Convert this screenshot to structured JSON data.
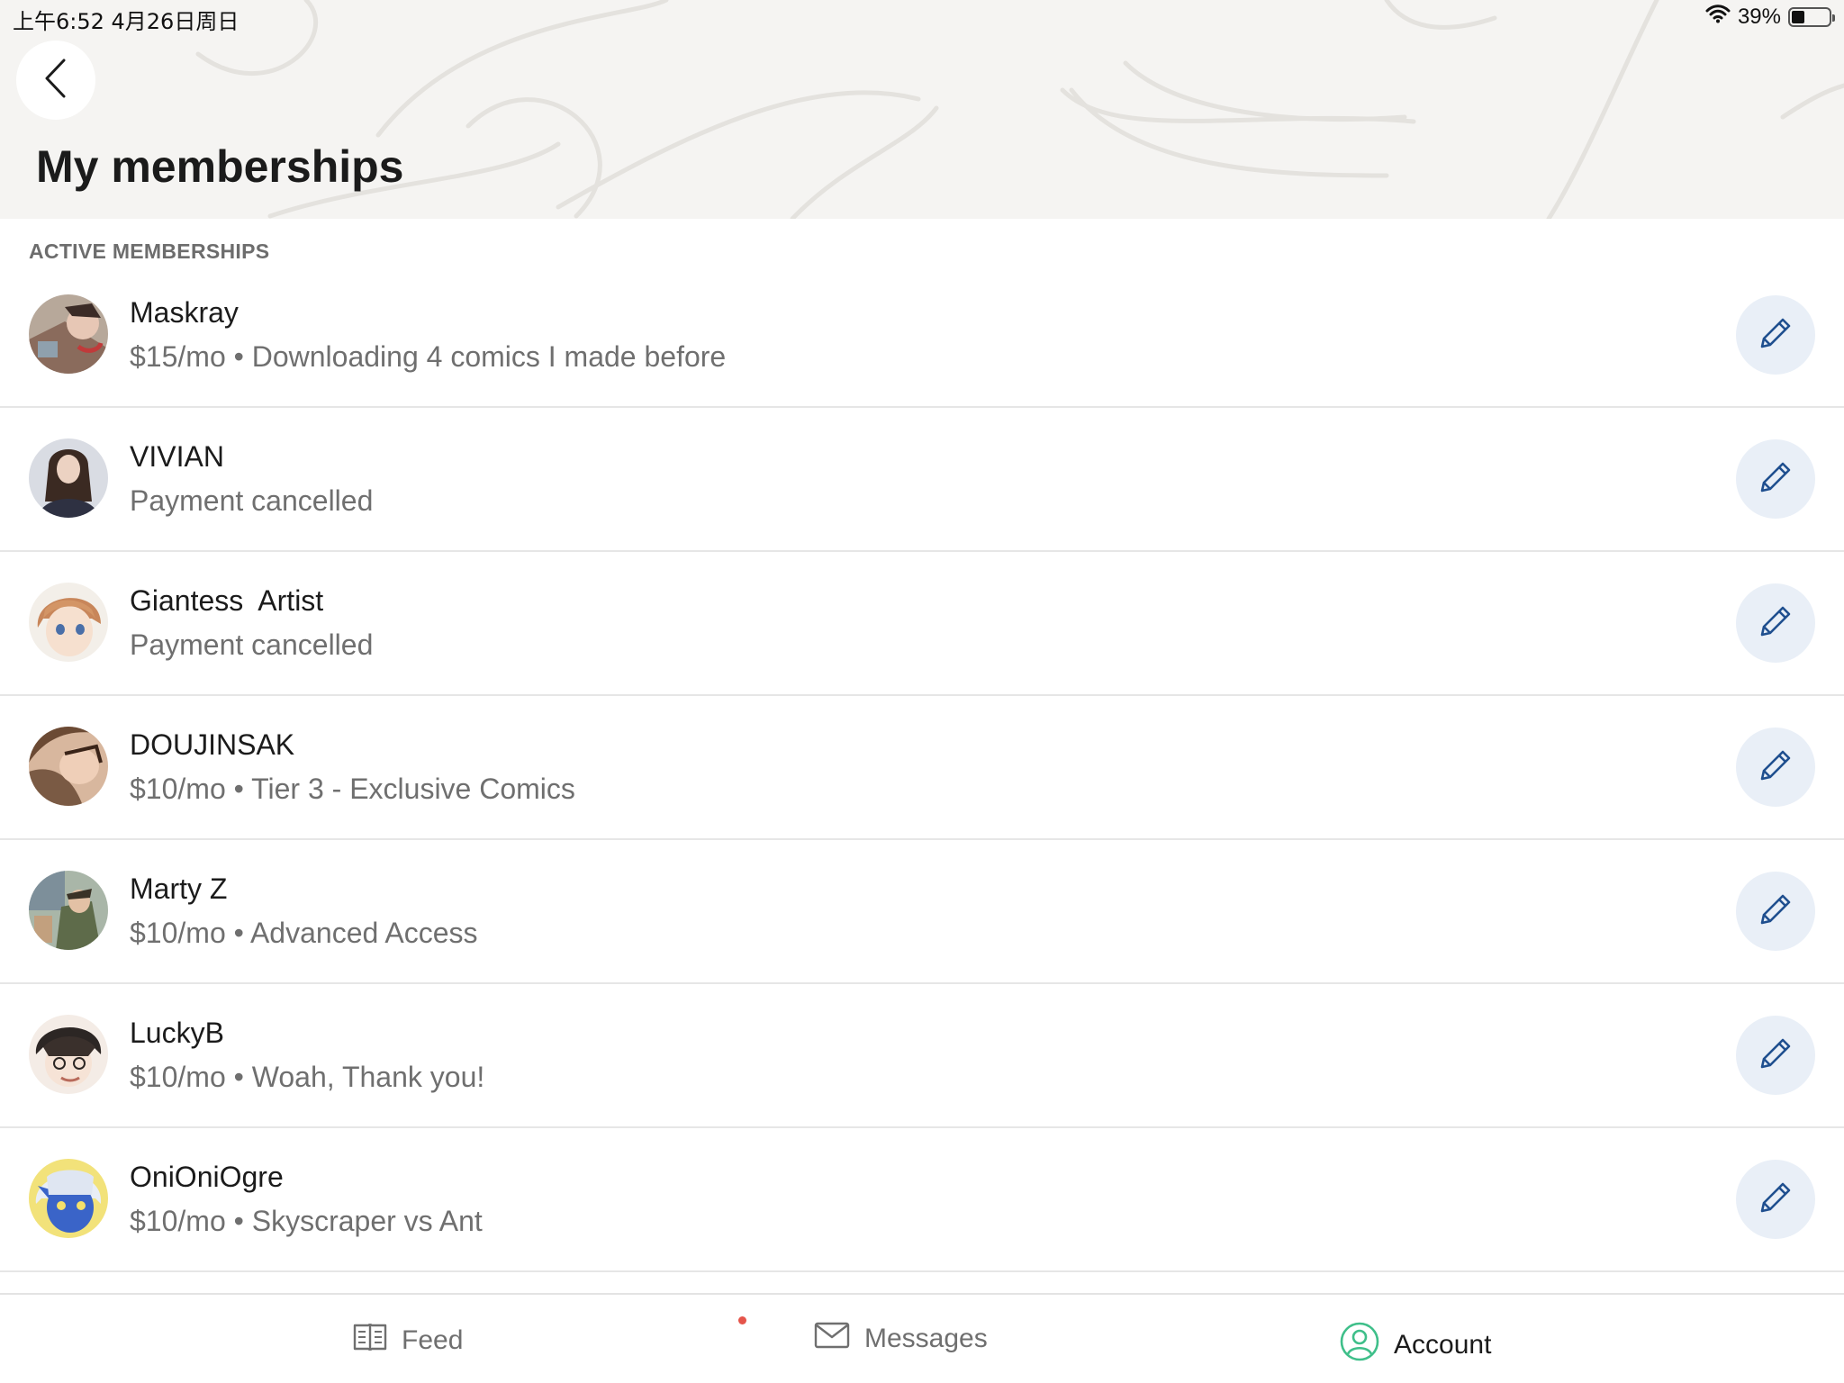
{
  "status_bar": {
    "time": "上午6:52   4月26日周日",
    "battery": "39%"
  },
  "header": {
    "title": "My memberships"
  },
  "section": {
    "label": "ACTIVE MEMBERSHIPS"
  },
  "memberships": [
    {
      "name": "Maskray",
      "detail": "$15/mo • Downloading 4 comics I made before",
      "avatar_color": "#8a6b5c"
    },
    {
      "name": "VIVIAN",
      "detail": "Payment cancelled",
      "avatar_color": "#2e3142"
    },
    {
      "name": "Giantess  Artist",
      "detail": "Payment cancelled",
      "avatar_color": "#d39566"
    },
    {
      "name": "DOUJINSAK",
      "detail": "$10/mo • Tier 3 - Exclusive Comics",
      "avatar_color": "#7a5a44"
    },
    {
      "name": "Marty Z",
      "detail": "$10/mo • Advanced Access",
      "avatar_color": "#5e6b4a"
    },
    {
      "name": "LuckyB",
      "detail": "$10/mo • Woah, Thank you!",
      "avatar_color": "#b98f7e"
    },
    {
      "name": "OniOniOgre",
      "detail": "$10/mo • Skyscraper vs Ant",
      "avatar_color": "#3a64c8"
    }
  ],
  "tabbar": {
    "feed": "Feed",
    "messages": "Messages",
    "account": "Account"
  },
  "colors": {
    "accent_icon": "#1f4f8f",
    "edit_bg": "#e9eff7",
    "account_green": "#3fbf8a",
    "notification": "#e5544a"
  }
}
